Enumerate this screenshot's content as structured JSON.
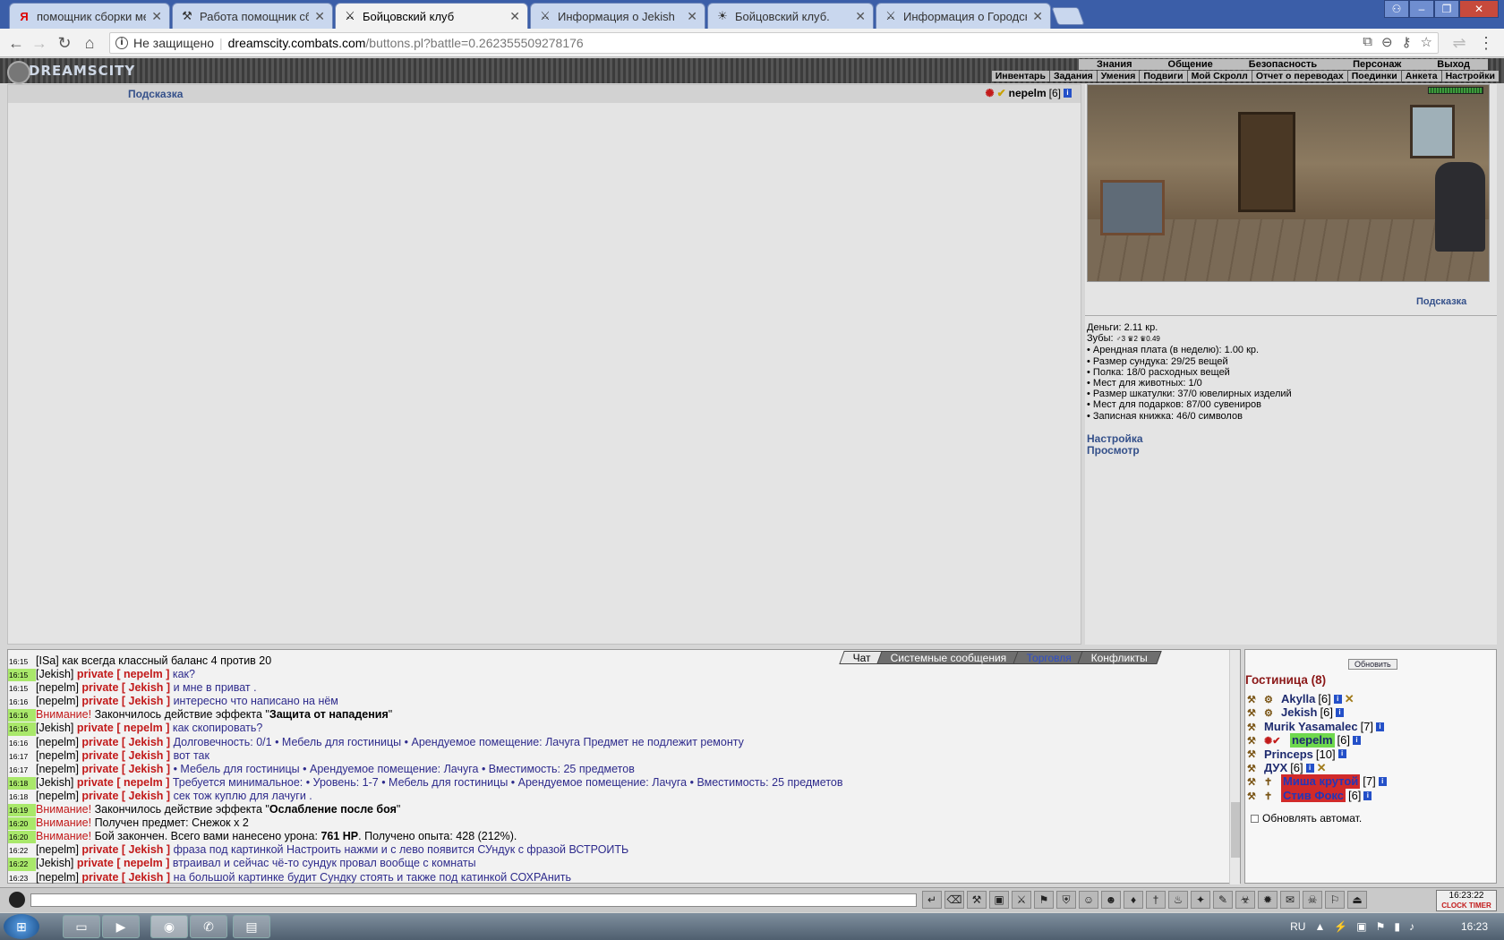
{
  "browser": {
    "tabs": [
      {
        "title": "помощник сборки мебели",
        "icon": "Я"
      },
      {
        "title": "Работа помощник сбор",
        "icon": "⚒"
      },
      {
        "title": "Бойцовский клуб",
        "icon": "⚔"
      },
      {
        "title": "Информация о Jekish",
        "icon": "⚔"
      },
      {
        "title": "Бойцовский клуб.",
        "icon": "☀"
      },
      {
        "title": "Информация о Городск",
        "icon": "⚔"
      }
    ],
    "address": {
      "security": "Не защищено",
      "domain": "dreamscity.combats.com",
      "path": "/buttons.pl?battle=0.262355509278176"
    }
  },
  "game": {
    "logo": "DREAMSCITY",
    "menu_top": [
      "Знания",
      "Общение",
      "Безопасность",
      "Персонаж",
      "Выход"
    ],
    "menu_sub": [
      "Инвентарь",
      "Задания",
      "Умения",
      "Подвиги",
      "Мой Скролл",
      "Отчет о переводах",
      "Поединки",
      "Анкета",
      "Настройки"
    ],
    "hint_left": "Подсказка",
    "character": {
      "name": "nepelm",
      "level": "[6]"
    },
    "hint_right": "Подсказка",
    "stats": {
      "money": "Деньги: 2.11 кр.",
      "teeth_label": "Зубы:",
      "teeth": "♂3 ♛2 ♛0.49",
      "items": [
        "• Арендная плата (в неделю): 1.00 кр.",
        "• Размер сундука: 29/25 вещей",
        "• Полка: 18/0 расходных вещей",
        "• Мест для животных: 1/0",
        "• Размер шкатулки: 37/0 ювелирных изделий",
        "• Мест для подарков: 87/00 сувениров",
        "• Записная книжка: 46/0 символов"
      ]
    },
    "links": [
      "Настройка",
      "Просмотр"
    ]
  },
  "chat": {
    "tabs": [
      "Чат",
      "Системные сообщения",
      "Торговля",
      "Конфликты"
    ],
    "lines": [
      {
        "t": "16:15",
        "hl": false,
        "nick": "[ISa]",
        "priv": "",
        "text": " как всегда классный баланс 4 против 20",
        "type": "plain"
      },
      {
        "t": "16:15",
        "hl": true,
        "nick": "[Jekish]",
        "priv": " private [ nepelm ] ",
        "text": "как?",
        "type": "priv"
      },
      {
        "t": "16:15",
        "hl": false,
        "nick": "[nepelm]",
        "priv": " private [ Jekish ] ",
        "text": "и мне в приват .",
        "type": "priv"
      },
      {
        "t": "16:16",
        "hl": false,
        "nick": "[nepelm]",
        "priv": " private [ Jekish ] ",
        "text": "интересно что написано на нём",
        "type": "priv"
      },
      {
        "t": "16:16",
        "hl": true,
        "warn": "Внимание!",
        "text": " Закончилось действие эффекта \"",
        "bold": "Защита от нападения",
        "tail": "\"",
        "type": "warn"
      },
      {
        "t": "16:16",
        "hl": true,
        "nick": "[Jekish]",
        "priv": " private [ nepelm ] ",
        "text": "как скопировать?",
        "type": "priv"
      },
      {
        "t": "16:16",
        "hl": false,
        "nick": "[nepelm]",
        "priv": " private [ Jekish ] ",
        "text": "Долговечность: 0/1 • Мебель для гостиницы • Арендуемое помещение: Лачуга Предмет не подлежит ремонту",
        "type": "priv"
      },
      {
        "t": "16:17",
        "hl": false,
        "nick": "[nepelm]",
        "priv": " private [ Jekish ] ",
        "text": "вот так",
        "type": "priv"
      },
      {
        "t": "16:17",
        "hl": false,
        "nick": "[nepelm]",
        "priv": " private [ Jekish ] ",
        "text": "• Мебель для гостиницы • Арендуемое помещение: Лачуга • Вместимость: 25 предметов",
        "type": "priv"
      },
      {
        "t": "16:18",
        "hl": true,
        "nick": "[Jekish]",
        "priv": " private [ nepelm ] ",
        "text": "Требуется минимальное: • Уровень: 1-7 • Мебель для гостиницы • Арендуемое помещение: Лачуга • Вместимость: 25 предметов",
        "type": "priv"
      },
      {
        "t": "16:18",
        "hl": false,
        "nick": "[nepelm]",
        "priv": " private [ Jekish ] ",
        "text": "сек тож куплю для лачуги .",
        "type": "priv"
      },
      {
        "t": "16:19",
        "hl": true,
        "warn": "Внимание!",
        "text": " Закончилось действие эффекта \"",
        "bold": "Ослабление после боя",
        "tail": "\"",
        "type": "warn"
      },
      {
        "t": "16:20",
        "hl": true,
        "warn": "Внимание!",
        "text": " Получен предмет: Снежок x 2",
        "bold": "",
        "tail": "",
        "type": "warn"
      },
      {
        "t": "16:20",
        "hl": true,
        "warn": "Внимание!",
        "text": " Бой закончен. Всего вами нанесено урона: ",
        "bold": "761 HP",
        "tail": ". Получено опыта: 428 (212%).",
        "type": "warn"
      },
      {
        "t": "16:22",
        "hl": false,
        "nick": "[nepelm]",
        "priv": " private [ Jekish ] ",
        "text": "фраза под картинкой Настроить нажми и с лево появится СУндук с фразой ВСТРОИТЬ",
        "type": "priv"
      },
      {
        "t": "16:22",
        "hl": true,
        "nick": "[Jekish]",
        "priv": " private [ nepelm ] ",
        "text": "втраивал и сейчас чё-то сундук провал вообще с комнаты",
        "type": "priv"
      },
      {
        "t": "16:23",
        "hl": false,
        "nick": "[nepelm]",
        "priv": " private [ Jekish ] ",
        "text": "на большой картинке будит Сундку стоять и также под катинкой СОХРАнить",
        "type": "priv"
      }
    ]
  },
  "users": {
    "refresh": "Обновить",
    "room": "Гостиница (8)",
    "list": [
      {
        "name": "Akylla",
        "lvl": "[6]",
        "style": "normal"
      },
      {
        "name": "Jekish",
        "lvl": "[6]",
        "style": "normal"
      },
      {
        "name": "Murik Yasamalec",
        "lvl": "[7]",
        "style": "normal"
      },
      {
        "name": "nepelm",
        "lvl": "[6]",
        "style": "me"
      },
      {
        "name": "Princeps",
        "lvl": "[10]",
        "style": "normal"
      },
      {
        "name": "ДУХ",
        "lvl": "[6]",
        "style": "normal"
      },
      {
        "name": "Миша крутой",
        "lvl": "[7]",
        "style": "red"
      },
      {
        "name": "Стив Фокс",
        "lvl": "[6]",
        "style": "red"
      }
    ],
    "auto": "Обновлять автомат."
  },
  "clock": {
    "time": "16:23:22",
    "label": "CLOCK TIMER"
  },
  "taskbar": {
    "lang": "RU",
    "time": "16:23"
  }
}
